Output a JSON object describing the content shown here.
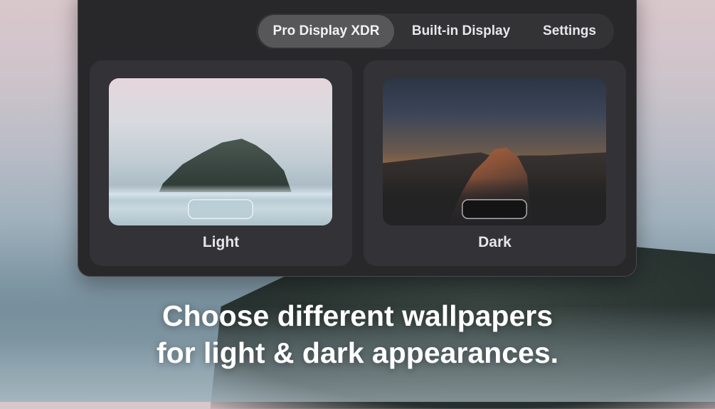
{
  "tabs": [
    {
      "label": "Pro Display XDR",
      "active": true
    },
    {
      "label": "Built-in Display",
      "active": false
    },
    {
      "label": "Settings",
      "active": false
    }
  ],
  "cards": {
    "light": {
      "label": "Light"
    },
    "dark": {
      "label": "Dark"
    }
  },
  "caption": {
    "line1": "Choose different wallpapers",
    "line2": "for light & dark appearances."
  },
  "colors": {
    "window_bg": "#28272a",
    "card_bg": "#333236",
    "tab_active_bg": "#575659",
    "text": "#e6e6ea"
  }
}
